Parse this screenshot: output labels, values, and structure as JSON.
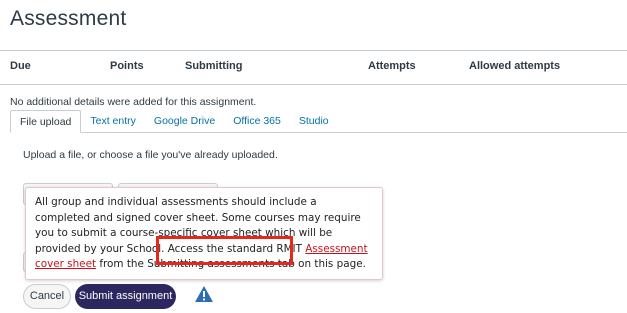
{
  "page": {
    "title": "Assessment"
  },
  "details_table": {
    "columns": [
      "Due",
      "Points",
      "Submitting",
      "Attempts",
      "Allowed attempts"
    ]
  },
  "no_details_text": "No additional details were added for this assignment.",
  "tabs": [
    {
      "label": "File upload",
      "active": true
    },
    {
      "label": "Text entry",
      "active": false
    },
    {
      "label": "Google Drive",
      "active": false
    },
    {
      "label": "Office 365",
      "active": false
    },
    {
      "label": "Studio",
      "active": false
    }
  ],
  "upload": {
    "hint": "Upload a file, or choose a file you've already uploaded."
  },
  "tooltip": {
    "text_before_link": "All group and individual assessments should include a completed and signed cover sheet. Some courses may require you to submit a course-specific cover sheet which will be provided by your School. Access the standard RMIT ",
    "link_text": "Assessment cover sheet",
    "text_after_link": " from the Submitting assessments tab on this page."
  },
  "buttons": {
    "cancel": "Cancel",
    "submit": "Submit assignment"
  },
  "icons": {
    "warning": "warning-triangle-icon"
  },
  "colors": {
    "accent": "#2d2760",
    "link": "#0770a3",
    "highlight": "#e8261c",
    "warning": "#2a6fb0"
  }
}
